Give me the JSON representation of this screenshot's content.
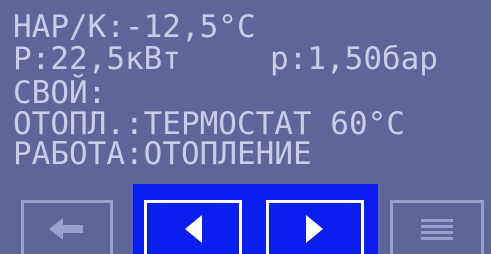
{
  "display": {
    "outside_temp_line": "НАР/К:-12,5°С",
    "power_line": "Р:22,5кВт",
    "pressure_text": "р:1,50бар",
    "source_line": "СВОЙ:",
    "heating_line": "ОТОПЛ.:ТЕРМОСТАТ 60°С",
    "mode_line": "РАБОТА:ОТОПЛЕНИЕ"
  },
  "buttons": {
    "back_icon": "arrow-left-icon",
    "prev_icon": "triangle-left-icon",
    "next_icon": "triangle-right-icon",
    "menu_icon": "menu-lines-icon"
  },
  "colors": {
    "background": "#5f6598",
    "text": "#c9cde9",
    "highlight": "#0a1ef0"
  }
}
